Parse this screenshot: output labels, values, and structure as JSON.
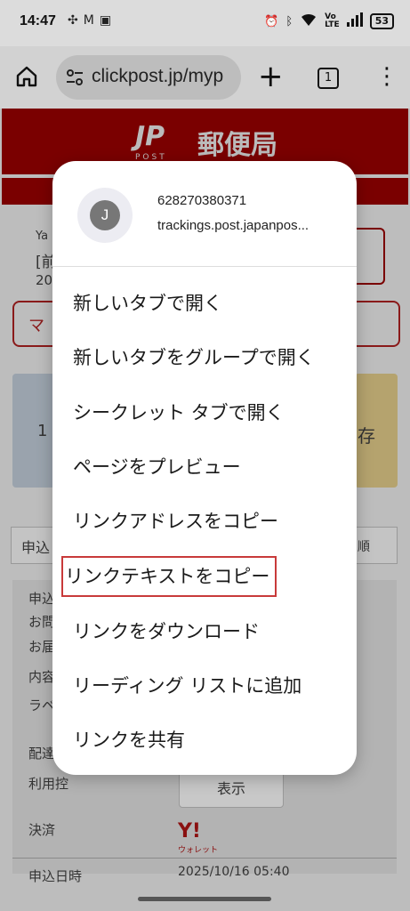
{
  "status_bar": {
    "time": "14:47",
    "battery": "53",
    "icons_left": [
      "pinwheel-icon",
      "gmail-icon",
      "app-icon"
    ],
    "icons_right": [
      "alarm-icon",
      "bluetooth-icon",
      "wifi-icon",
      "volte-icon",
      "signal-icon",
      "battery-icon"
    ]
  },
  "browser": {
    "url": "clickpost.jp/myp",
    "tab_count": "1"
  },
  "background_page": {
    "brand_logo": "JP",
    "brand_post": "POST",
    "brand_name": "郵便局",
    "row_labels": [
      "申込",
      "お問",
      "お届",
      "内容",
      "ラベ",
      "配達",
      "利用控",
      "決済"
    ],
    "fragments": [
      "Ya",
      "[前",
      "20",
      "マ",
      "1",
      "存",
      "申込",
      "順"
    ],
    "show_button": "表示",
    "ypay_logo": "Y!",
    "ypay_caption": "ウォレット",
    "applied_label": "申込日時",
    "applied_value": "2025/10/16 05:40"
  },
  "context_menu": {
    "avatar_letter": "J",
    "link_title": "628270380371",
    "link_url": "trackings.post.japanpos...",
    "items": [
      "新しいタブで開く",
      "新しいタブをグループで開く",
      "シークレット タブで開く",
      "ページをプレビュー",
      "リンクアドレスをコピー",
      "リンクテキストをコピー",
      "リンクをダウンロード",
      "リーディング リストに追加",
      "リンクを共有"
    ],
    "highlighted_index": 5
  }
}
